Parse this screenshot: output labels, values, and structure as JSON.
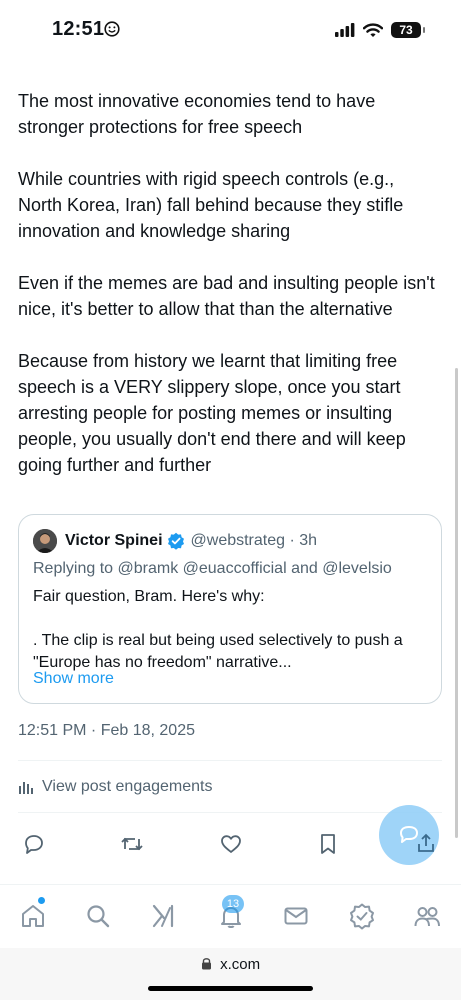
{
  "status_bar": {
    "time": "12:51",
    "battery": "73"
  },
  "tweet": {
    "paragraphs": [
      "The most innovative economies tend to have stronger protections for free speech",
      "While countries with rigid speech controls (e.g., North Korea, Iran) fall behind because they stifle innovation and knowledge sharing",
      "Even if the memes are bad and insulting people isn't nice, it's better to allow that than the alternative",
      "Because from history we learnt that limiting free speech is a VERY slippery slope, once you start arresting people for posting memes or insulting people, you usually don't end there and will keep going further and further"
    ],
    "timestamp": "12:51 PM · Feb 18, 2025",
    "engagements_label": "View post engagements"
  },
  "quote": {
    "author_name": "Victor Spinei",
    "handle_time": "@webstrateg · 3h",
    "replying_to": "Replying to @bramk @euaccofficial and @levelsio",
    "lines": [
      "Fair question, Bram. Here's why:",
      "",
      ". The clip is real but being used selectively to push a",
      "\"Europe has no freedom\" narrative..."
    ],
    "show_more": "Show more"
  },
  "tab_bar": {
    "notifications_badge": "13"
  },
  "browser": {
    "url": "x.com"
  },
  "colors": {
    "accent": "#1d9bf0",
    "secondary_text": "#536471",
    "text": "#0f1419"
  }
}
